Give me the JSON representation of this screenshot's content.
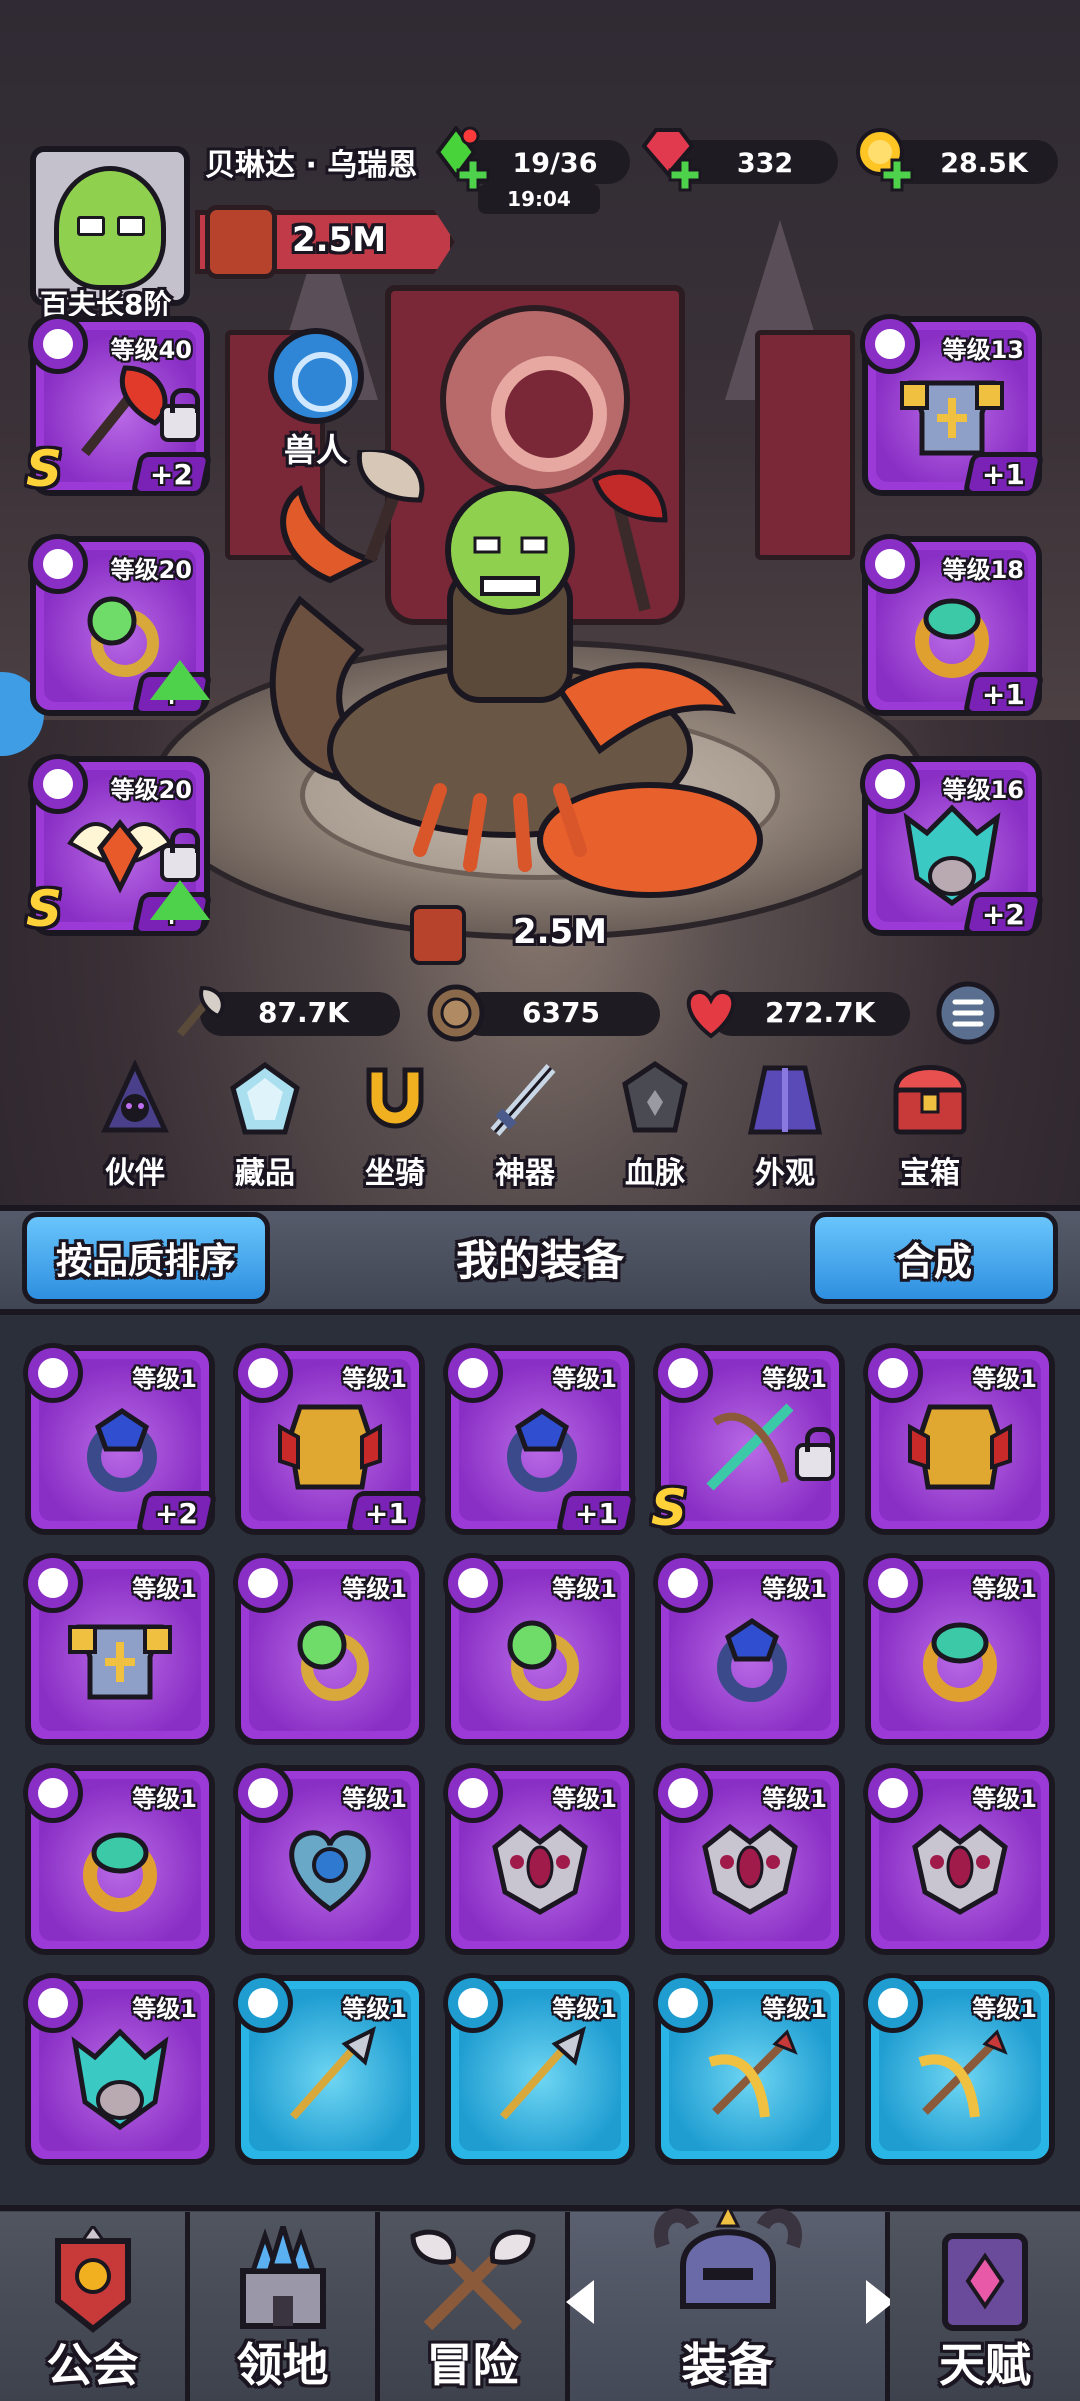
{
  "player": {
    "name": "贝琳达 · 乌瑞恩",
    "rank": "百夫长8阶",
    "power": "2.5M"
  },
  "resources": {
    "energy": "19/36",
    "energy_timer": "19:04",
    "gems": "332",
    "gold": "28.5K"
  },
  "hero": {
    "race": "兽人",
    "power": "2.5M",
    "stats": {
      "attack": "87.7K",
      "defense": "6375",
      "health": "272.7K"
    }
  },
  "equipped_left": [
    {
      "level": "等级40",
      "type": "axe",
      "plus": "+2",
      "grade": "S",
      "locked": true,
      "upgrade": false,
      "item": "fire-axe"
    },
    {
      "level": "等级20",
      "type": "ring",
      "plus": "+",
      "grade": "",
      "locked": false,
      "upgrade": true,
      "item": "green-orb-ring"
    },
    {
      "level": "等级20",
      "type": "amulet",
      "plus": "+",
      "grade": "S",
      "locked": true,
      "upgrade": true,
      "item": "winged-amulet"
    }
  ],
  "equipped_right": [
    {
      "level": "等级13",
      "type": "armor",
      "plus": "+1",
      "item": "plate-armor"
    },
    {
      "level": "等级18",
      "type": "ring",
      "plus": "+1",
      "item": "jade-ring"
    },
    {
      "level": "等级16",
      "type": "amulet",
      "plus": "+2",
      "item": "teal-helm"
    }
  ],
  "categories": [
    "伙伴",
    "藏品",
    "坐骑",
    "神器",
    "血脉",
    "外观",
    "宝箱"
  ],
  "list": {
    "sort_label": "按品质排序",
    "title": "我的装备",
    "merge_label": "合成"
  },
  "inventory": [
    {
      "level": "等级1",
      "type": "ring",
      "plus": "+2",
      "grade": "",
      "locked": false,
      "rarity": "epic",
      "item": "blue-ring"
    },
    {
      "level": "等级1",
      "type": "armor",
      "plus": "+1",
      "grade": "",
      "locked": false,
      "rarity": "epic",
      "item": "gold-armor"
    },
    {
      "level": "等级1",
      "type": "ring",
      "plus": "+1",
      "grade": "",
      "locked": false,
      "rarity": "epic",
      "item": "blue-ring"
    },
    {
      "level": "等级1",
      "type": "axe",
      "plus": "",
      "grade": "S",
      "locked": true,
      "rarity": "epic",
      "item": "green-bow"
    },
    {
      "level": "等级1",
      "type": "armor",
      "plus": "",
      "grade": "",
      "locked": false,
      "rarity": "epic",
      "item": "gold-armor"
    },
    {
      "level": "等级1",
      "type": "armor",
      "plus": "",
      "grade": "",
      "locked": false,
      "rarity": "epic",
      "item": "plate-armor"
    },
    {
      "level": "等级1",
      "type": "ring",
      "plus": "",
      "grade": "",
      "locked": false,
      "rarity": "epic",
      "item": "green-orb-ring"
    },
    {
      "level": "等级1",
      "type": "ring",
      "plus": "",
      "grade": "",
      "locked": false,
      "rarity": "epic",
      "item": "green-orb-ring"
    },
    {
      "level": "等级1",
      "type": "ring",
      "plus": "",
      "grade": "",
      "locked": false,
      "rarity": "epic",
      "item": "blue-ring"
    },
    {
      "level": "等级1",
      "type": "ring",
      "plus": "",
      "grade": "",
      "locked": false,
      "rarity": "epic",
      "item": "jade-ring"
    },
    {
      "level": "等级1",
      "type": "ring",
      "plus": "",
      "grade": "",
      "locked": false,
      "rarity": "epic",
      "item": "jade-ring"
    },
    {
      "level": "等级1",
      "type": "amulet",
      "plus": "",
      "grade": "",
      "locked": false,
      "rarity": "epic",
      "item": "blue-heart"
    },
    {
      "level": "等级1",
      "type": "amulet",
      "plus": "",
      "grade": "",
      "locked": false,
      "rarity": "epic",
      "item": "pink-mask"
    },
    {
      "level": "等级1",
      "type": "amulet",
      "plus": "",
      "grade": "",
      "locked": false,
      "rarity": "epic",
      "item": "pink-mask"
    },
    {
      "level": "等级1",
      "type": "amulet",
      "plus": "",
      "grade": "",
      "locked": false,
      "rarity": "epic",
      "item": "pink-mask"
    },
    {
      "level": "等级1",
      "type": "amulet",
      "plus": "",
      "grade": "",
      "locked": false,
      "rarity": "epic",
      "item": "teal-helm"
    },
    {
      "level": "等级1",
      "type": "axe",
      "plus": "",
      "grade": "",
      "locked": false,
      "rarity": "rare",
      "item": "spear"
    },
    {
      "level": "等级1",
      "type": "axe",
      "plus": "",
      "grade": "",
      "locked": false,
      "rarity": "rare",
      "item": "spear"
    },
    {
      "level": "等级1",
      "type": "axe",
      "plus": "",
      "grade": "",
      "locked": false,
      "rarity": "rare",
      "item": "crossbow"
    },
    {
      "level": "等级1",
      "type": "axe",
      "plus": "",
      "grade": "",
      "locked": false,
      "rarity": "rare",
      "item": "crossbow"
    }
  ],
  "nav": [
    {
      "label": "公会",
      "icon": "guild-banner-icon"
    },
    {
      "label": "领地",
      "icon": "castle-icon"
    },
    {
      "label": "冒险",
      "icon": "crossed-axes-icon"
    },
    {
      "label": "装备",
      "icon": "helmet-icon",
      "active": true
    },
    {
      "label": "天赋",
      "icon": "talent-book-icon"
    }
  ],
  "colors": {
    "epic": "#9b3ad7",
    "rare": "#29b6e6",
    "accent_blue": "#2e8fe0"
  }
}
